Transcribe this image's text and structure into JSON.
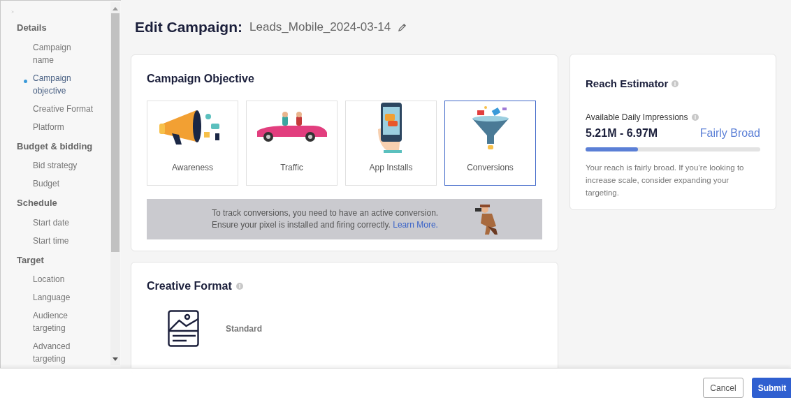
{
  "sidebar": {
    "sections": [
      {
        "label": "Details",
        "items": [
          {
            "label": "Campaign name",
            "selected": false
          },
          {
            "label": "Campaign objective",
            "selected": true
          },
          {
            "label": "Creative Format",
            "selected": false
          },
          {
            "label": "Platform",
            "selected": false
          }
        ]
      },
      {
        "label": "Budget & bidding",
        "items": [
          {
            "label": "Bid strategy",
            "selected": false
          },
          {
            "label": "Budget",
            "selected": false
          }
        ]
      },
      {
        "label": "Schedule",
        "items": [
          {
            "label": "Start date",
            "selected": false
          },
          {
            "label": "Start time",
            "selected": false
          }
        ]
      },
      {
        "label": "Target",
        "items": [
          {
            "label": "Location",
            "selected": false
          },
          {
            "label": "Language",
            "selected": false
          },
          {
            "label": "Audience targeting",
            "selected": false
          },
          {
            "label": "Advanced targeting",
            "selected": false
          }
        ]
      }
    ]
  },
  "header": {
    "title": "Edit Campaign:",
    "campaign_name": "Leads_Mobile_2024-03-14"
  },
  "objective": {
    "title": "Campaign Objective",
    "options": [
      {
        "kind": "megaphone",
        "label": "Awareness",
        "selected": false
      },
      {
        "kind": "car",
        "label": "Traffic",
        "selected": false
      },
      {
        "kind": "phone",
        "label": "App Installs",
        "selected": false
      },
      {
        "kind": "funnel",
        "label": "Conversions",
        "selected": true
      }
    ],
    "notice": {
      "text": "To track conversions, you need to have an active conversion. Ensure your pixel is installed and firing correctly.",
      "link": "Learn More."
    }
  },
  "creative_format": {
    "title": "Creative Format",
    "option": "Standard"
  },
  "reach": {
    "title": "Reach Estimator",
    "metric_label": "Available Daily Impressions",
    "range": "5.21M - 6.97M",
    "rating": "Fairly Broad",
    "level": 0.3,
    "description": "Your reach is fairly broad. If you’re looking to increase scale, consider expanding your targeting."
  },
  "footer": {
    "buttons": [
      {
        "kind": "secondary",
        "label": "Cancel"
      },
      {
        "kind": "primary",
        "label": "Submit"
      }
    ]
  }
}
